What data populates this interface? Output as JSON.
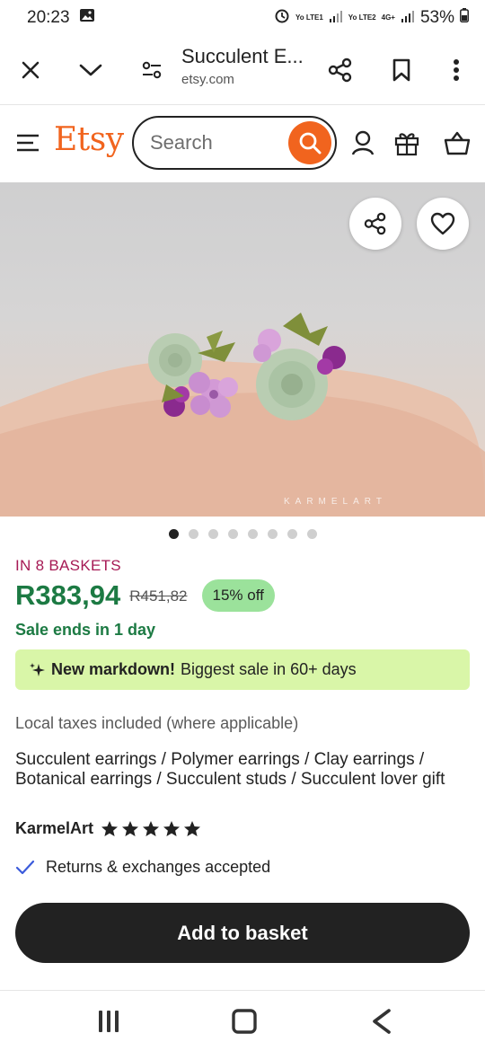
{
  "status_bar": {
    "time": "20:23",
    "net1": "Yo LTE1",
    "net2": "Yo LTE2",
    "net3": "4G+",
    "battery": "53%"
  },
  "browser": {
    "page_title": "Succulent E...",
    "url": "etsy.com"
  },
  "header": {
    "logo": "Etsy",
    "search_placeholder": "Search"
  },
  "product": {
    "watermark": "KARMELART",
    "image_count": 8,
    "active_image": 1,
    "baskets": "IN 8 BASKETS",
    "price": "R383,94",
    "original_price": "R451,82",
    "discount": "15% off",
    "sale_ends": "Sale ends in 1 day",
    "markdown_bold": "New markdown!",
    "markdown_rest": "Biggest sale in 60+ days",
    "taxes": "Local taxes included (where applicable)",
    "title": "Succulent earrings / Polymer earrings / Clay earrings / Botanical earrings / Succulent studs / Succulent lover gift",
    "shop_name": "KarmelArt",
    "rating_stars": 5,
    "returns": "Returns & exchanges accepted",
    "add_to_basket": "Add to basket"
  },
  "colors": {
    "etsy_orange": "#f1641e",
    "sale_green": "#1c7a43",
    "badge_green": "#9be29b",
    "banner_green": "#d9f6a8",
    "baskets_pink": "#a61a55"
  }
}
